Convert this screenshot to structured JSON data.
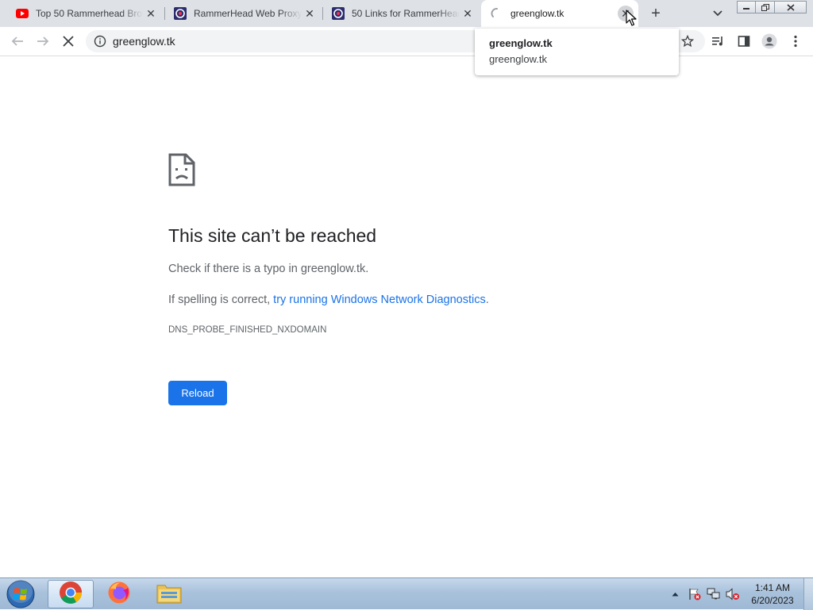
{
  "browser": {
    "tabs": [
      {
        "title": "Top 50 Rammerhead Browser",
        "favicon": "youtube-icon",
        "active": false
      },
      {
        "title": "RammerHead Web Proxy",
        "favicon": "proxy-site-icon",
        "active": false
      },
      {
        "title": "50 Links for RammerHead",
        "favicon": "proxy-site-icon",
        "active": false
      },
      {
        "title": "greenglow.tk",
        "favicon": "loading-spinner-icon",
        "active": true
      }
    ],
    "new_tab_label": "+",
    "address": "greenglow.tk",
    "hover_card": {
      "title": "greenglow.tk",
      "domain": "greenglow.tk"
    }
  },
  "error_page": {
    "heading": "This site can’t be reached",
    "line1": "Check if there is a typo in greenglow.tk.",
    "line2_prefix": "If spelling is correct, ",
    "line2_link": "try running Windows Network Diagnostics",
    "line2_suffix": ".",
    "error_code": "DNS_PROBE_FINISHED_NXDOMAIN",
    "reload_label": "Reload"
  },
  "taskbar": {
    "apps": [
      "chrome-icon",
      "firefox-icon",
      "file-explorer-icon"
    ],
    "clock_time": "1:41 AM",
    "clock_date": "6/20/2023"
  },
  "colors": {
    "accent": "#1a73e8",
    "youtube_red": "#ff0000",
    "tab_strip": "#dee1e6"
  }
}
